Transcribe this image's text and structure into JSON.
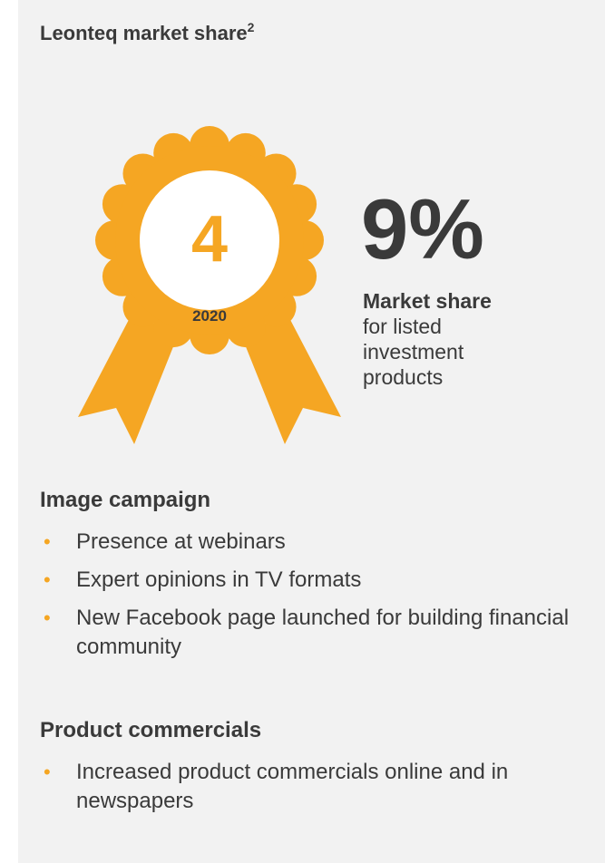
{
  "title": {
    "text": "Leonteq market share",
    "sup": "2"
  },
  "badge": {
    "rank": "4",
    "year": "2020",
    "color": "#f5a623"
  },
  "market_share": {
    "value": "9%",
    "label_bold": "Market share",
    "label_rest_1": "for listed",
    "label_rest_2": "investment",
    "label_rest_3": "products"
  },
  "image_campaign": {
    "title": "Image campaign",
    "items": [
      "Presence at webinars",
      "Expert opinions in TV formats",
      "New Facebook page launched for building financial community"
    ]
  },
  "product_commercials": {
    "title": "Product commercials",
    "items": [
      "Increased product commercials online and in newspapers"
    ]
  },
  "bullet_glyph": "•"
}
